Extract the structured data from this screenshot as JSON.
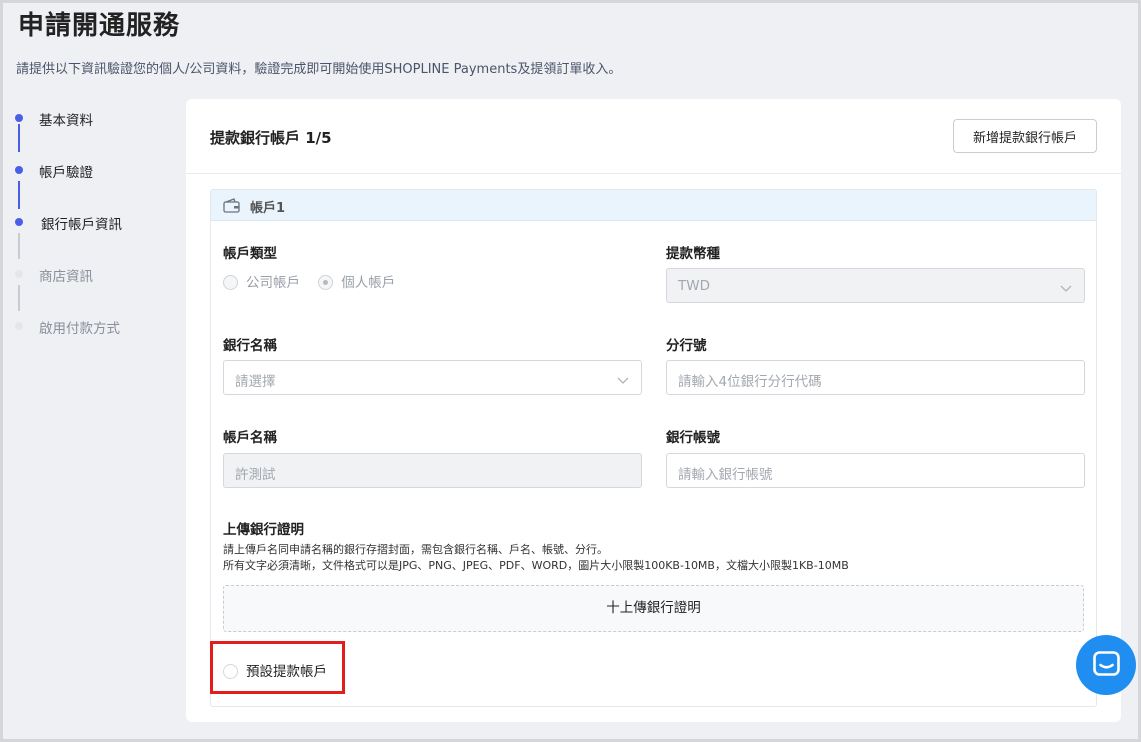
{
  "page": {
    "title": "申請開通服務",
    "description": "請提供以下資訊驗證您的個人/公司資料，驗證完成即可開始使用SHOPLINE Payments及提領訂單收入。"
  },
  "steps": [
    {
      "label": "基本資料",
      "state": "done"
    },
    {
      "label": "帳戶驗證",
      "state": "done"
    },
    {
      "label": "銀行帳戶資訊",
      "state": "active"
    },
    {
      "label": "商店資訊",
      "state": "pending"
    },
    {
      "label": "啟用付款方式",
      "state": "pending"
    }
  ],
  "card": {
    "title": "提款銀行帳戶 1/5",
    "add_button": "新增提款銀行帳戶"
  },
  "account": {
    "header": "帳戶1",
    "account_type": {
      "label": "帳戶類型",
      "options": [
        "公司帳戶",
        "個人帳戶"
      ],
      "selected": "個人帳戶"
    },
    "currency": {
      "label": "提款幣種",
      "value": "TWD"
    },
    "bank_name": {
      "label": "銀行名稱",
      "placeholder": "請選擇"
    },
    "branch": {
      "label": "分行號",
      "placeholder": "請輸入4位銀行分行代碼"
    },
    "account_name": {
      "label": "帳戶名稱",
      "value": "許測試"
    },
    "account_number": {
      "label": "銀行帳號",
      "placeholder": "請輸入銀行帳號"
    },
    "upload": {
      "label": "上傳銀行證明",
      "help_line1": "請上傳戶名同申請名稱的銀行存摺封面，需包含銀行名稱、戶名、帳號、分行。",
      "help_line2": "所有文字必須清晰，文件格式可以是JPG、PNG、JPEG、PDF、WORD，圖片大小限製100KB-10MB，文檔大小限製1KB-10MB",
      "button": "十上傳銀行證明"
    },
    "default_label": "預設提款帳戶"
  },
  "colors": {
    "accent": "#4a5fe8",
    "highlight": "#e11d1d",
    "chat": "#1f8ef0"
  }
}
